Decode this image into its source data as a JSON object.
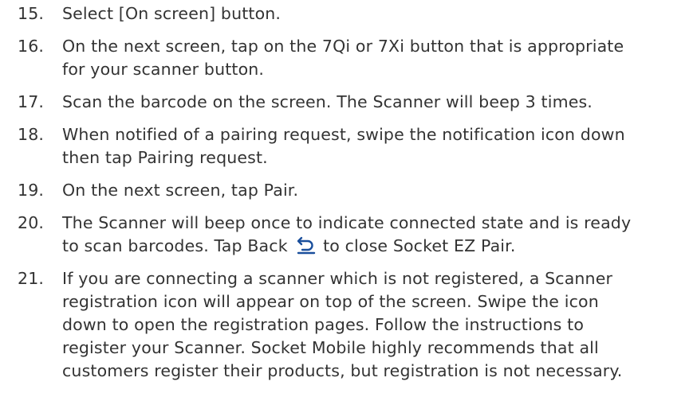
{
  "steps": [
    {
      "number": "15.",
      "lines": [
        "Select [On screen] button."
      ]
    },
    {
      "number": "16.",
      "lines": [
        "On the next screen, tap on the 7Qi or 7Xi button that is appropriate",
        "for your scanner button."
      ]
    },
    {
      "number": "17.",
      "lines": [
        "Scan the barcode on the screen. The Scanner will beep 3 times."
      ]
    },
    {
      "number": "18.",
      "lines": [
        "When notified of a pairing request, swipe the notification icon down",
        "then tap Pairing request."
      ]
    },
    {
      "number": "19.",
      "lines": [
        "On the next screen, tap Pair."
      ]
    },
    {
      "number": "20.",
      "lines": [
        "The Scanner will beep once to indicate connected state and is ready"
      ],
      "line2_before_icon": "to scan barcodes. Tap Back",
      "line2_after_icon": "to close Socket EZ Pair.",
      "icon": "back-arrow-icon"
    },
    {
      "number": "21.",
      "lines": [
        "If you are connecting a scanner which is not registered, a Scanner",
        "registration icon will appear on top of the screen. Swipe the icon",
        "down to open the registration pages. Follow the instructions to",
        "register your Scanner. Socket Mobile highly recommends that all",
        "customers register their products, but registration is not necessary."
      ]
    }
  ],
  "colors": {
    "text": "#333333",
    "icon": "#1a4f9c"
  }
}
